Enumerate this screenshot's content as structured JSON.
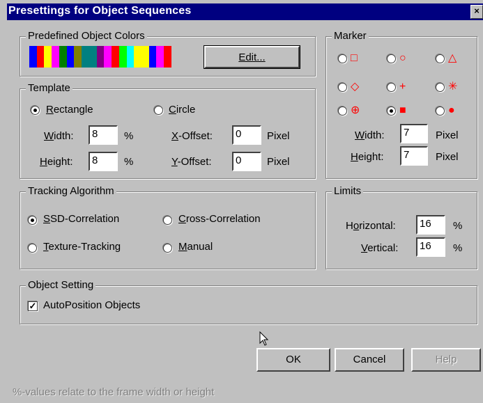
{
  "dialog": {
    "title": "Presettings for Object Sequences",
    "close_glyph": "×"
  },
  "colors": {
    "legend": "Predefined Object Colors",
    "edit_button": "Edit...",
    "swatches": [
      "#0000ff",
      "#ff0000",
      "#ffff00",
      "#ff00ff",
      "#008000",
      "#0000ff",
      "#808000",
      "#008080",
      "#008080",
      "#800080",
      "#ff00ff",
      "#ff0000",
      "#00ff00",
      "#00ffff",
      "#ffff00",
      "#ffff00",
      "#0000ff",
      "#ff00ff",
      "#ff0000"
    ]
  },
  "template": {
    "legend": "Template",
    "rectangle_pre": "",
    "rectangle_u": "R",
    "rectangle_post": "ectangle",
    "circle_pre": "",
    "circle_u": "C",
    "circle_post": "ircle",
    "selected": "rectangle",
    "width_u": "W",
    "width_post": "idth:",
    "width_value": "8",
    "width_unit": "%",
    "height_u": "H",
    "height_post": "eight:",
    "height_value": "8",
    "height_unit": "%",
    "xoffset_u": "X",
    "xoffset_post": "-Offset:",
    "xoffset_value": "0",
    "xoffset_unit": "Pixel",
    "yoffset_u": "Y",
    "yoffset_post": "-Offset:",
    "yoffset_value": "0",
    "yoffset_unit": "Pixel"
  },
  "marker": {
    "legend": "Marker",
    "symbols": [
      "□",
      "○",
      "△",
      "◇",
      "+",
      "✳",
      "⊕",
      "■",
      "●"
    ],
    "selected_index": 7,
    "width_u": "W",
    "width_post": "idth:",
    "width_value": "7",
    "width_unit": "Pixel",
    "height_u": "H",
    "height_post": "eight:",
    "height_value": "7",
    "height_unit": "Pixel",
    "symbol_color": "#ff0000"
  },
  "tracking": {
    "legend": "Tracking Algorithm",
    "ssd_u": "S",
    "ssd_post": "SD-Correlation",
    "cross_u": "C",
    "cross_post": "ross-Correlation",
    "texture_u": "T",
    "texture_post": "exture-Tracking",
    "manual_u": "M",
    "manual_post": "anual",
    "selected": "ssd"
  },
  "limits": {
    "legend": "Limits",
    "horizontal_pre": "H",
    "horizontal_u": "o",
    "horizontal_post": "rizontal:",
    "horizontal_value": "16",
    "horizontal_unit": "%",
    "vertical_u": "V",
    "vertical_post": "ertical:",
    "vertical_value": "16",
    "vertical_unit": "%"
  },
  "object_setting": {
    "legend": "Object Setting",
    "autoposition_label": "AutoPosition Objects",
    "autoposition_checked": true,
    "check_glyph": "✓"
  },
  "buttons": {
    "ok": "OK",
    "cancel": "Cancel",
    "help": "Help"
  },
  "footer": {
    "hint": "%-values relate to the frame width or height"
  }
}
